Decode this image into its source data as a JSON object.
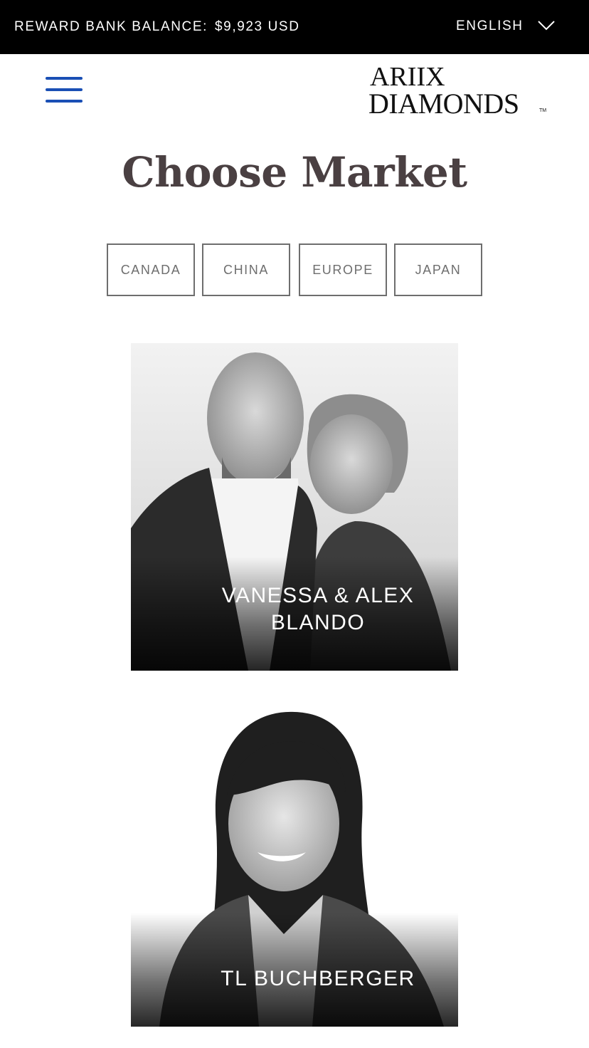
{
  "topbar": {
    "balance_label": "REWARD BANK BALANCE:",
    "balance_amount": "$9,923 USD",
    "language": "ENGLISH"
  },
  "logo": {
    "line1": "ARIIX",
    "line2": "DIAMONDS",
    "trademark": "TM"
  },
  "page_title": "Choose Market",
  "markets": [
    "CANADA",
    "CHINA",
    "EUROPE",
    "JAPAN"
  ],
  "cards": [
    {
      "name": "VANESSA & ALEX BLANDO"
    },
    {
      "name": "TL BUCHBERGER"
    }
  ],
  "colors": {
    "topbar_bg": "#000000",
    "menu_icon": "#1a4fb5",
    "title": "#4a4042",
    "button_border": "#6e6e6e"
  },
  "icons": {
    "menu": "hamburger-menu-icon",
    "language_dropdown": "chevron-down-icon"
  }
}
